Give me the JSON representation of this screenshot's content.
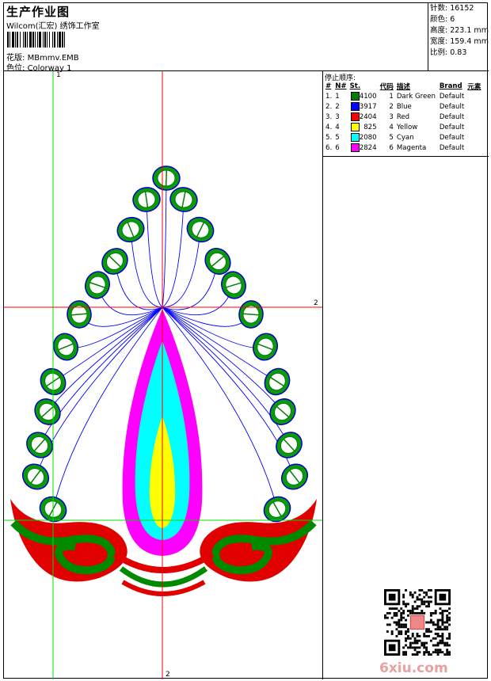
{
  "header": {
    "title": "生产作业图",
    "company": "Wilcom(汇宏) 绣饰工作室",
    "design_label": "花版:",
    "design_value": "MBmmv.EMB",
    "colorway_label": "色位:",
    "colorway_value": "Colorway 1"
  },
  "stats": {
    "stitches": "针数: 16152",
    "colors": "颜色: 6",
    "height": "高度: 223.1 mm",
    "width": "宽度: 159.4 mm",
    "scale": "比例: 0.83"
  },
  "stop_sequence": {
    "title": "停止顺序:",
    "headers": [
      "#",
      "N#",
      "St.",
      "代码",
      "描述",
      "Brand",
      "元素"
    ],
    "rows": [
      {
        "idx": "1.",
        "n": "1",
        "color": "#008000",
        "st": "4100",
        "code": "1",
        "desc": "Dark Green",
        "brand": "Default"
      },
      {
        "idx": "2.",
        "n": "2",
        "color": "#0000ff",
        "st": "3917",
        "code": "2",
        "desc": "Blue",
        "brand": "Default"
      },
      {
        "idx": "3.",
        "n": "3",
        "color": "#ff0000",
        "st": "2404",
        "code": "3",
        "desc": "Red",
        "brand": "Default"
      },
      {
        "idx": "4.",
        "n": "4",
        "color": "#ffff00",
        "st": "825",
        "code": "4",
        "desc": "Yellow",
        "brand": "Default"
      },
      {
        "idx": "5.",
        "n": "5",
        "color": "#00ffff",
        "st": "2080",
        "code": "5",
        "desc": "Cyan",
        "brand": "Default"
      },
      {
        "idx": "6.",
        "n": "6",
        "color": "#ff00ff",
        "st": "2824",
        "code": "6",
        "desc": "Magenta",
        "brand": "Default"
      }
    ]
  },
  "guides": {
    "vertical_top_label": "1",
    "horizontal_label": "2",
    "vertical_bottom_label": "2"
  },
  "watermark": "6xiu.com",
  "icons": {
    "qr": "qr-code-icon"
  }
}
